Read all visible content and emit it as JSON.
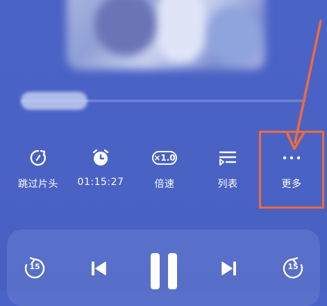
{
  "actions": {
    "skip_intro": {
      "label": "跳过片头",
      "icon": "skip-intro-icon"
    },
    "timer": {
      "label": "01:15:27",
      "icon": "alarm-clock-icon"
    },
    "speed": {
      "label": "倍速",
      "badge": "×1.0",
      "icon": "speed-badge-icon"
    },
    "playlist": {
      "label": "列表",
      "icon": "playlist-icon"
    },
    "more": {
      "label": "更多",
      "icon": "more-dots-icon"
    }
  },
  "player": {
    "rewind_seconds": "15",
    "forward_seconds": "15",
    "state": "playing"
  },
  "colors": {
    "background": "#4a63c6",
    "highlight": "#f06a3a",
    "foreground": "#ffffff"
  }
}
